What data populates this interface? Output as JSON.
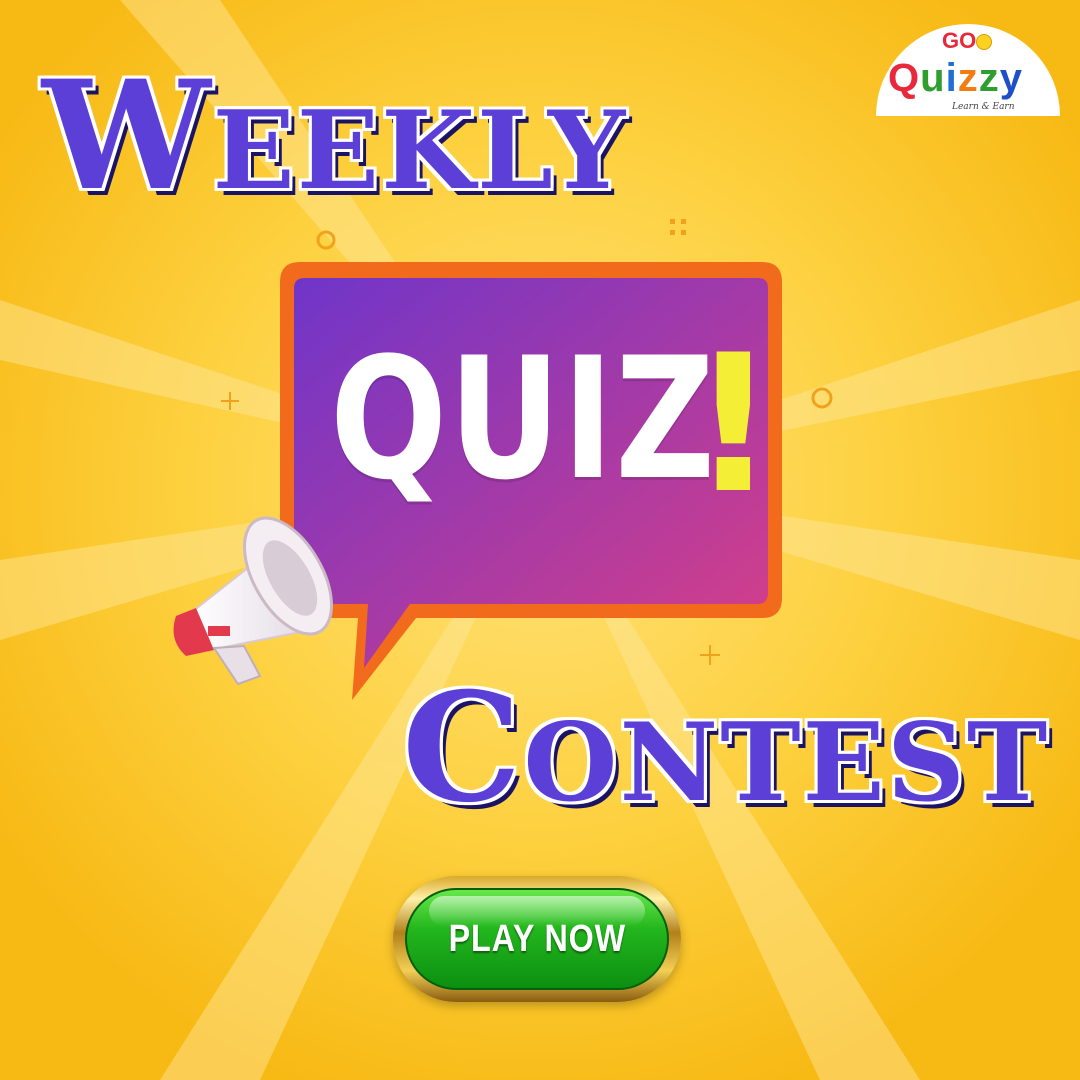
{
  "title_top": {
    "cap": "W",
    "rest": "EEKLY"
  },
  "title_bottom": {
    "cap": "C",
    "rest": "ONTEST"
  },
  "logo": {
    "go": "GO",
    "letters": [
      {
        "ch": "Q",
        "color": "#E8293B"
      },
      {
        "ch": "u",
        "color": "#2E9E2E"
      },
      {
        "ch": "i",
        "color": "#1F6FD6"
      },
      {
        "ch": "z",
        "color": "#F07C12"
      },
      {
        "ch": "z",
        "color": "#2E9E2E"
      },
      {
        "ch": "y",
        "color": "#1F4FC8"
      }
    ],
    "tagline": "Learn & Earn"
  },
  "bubble": {
    "word": "QUIZ",
    "mark": "!"
  },
  "play_button": {
    "label": "PLAY NOW"
  },
  "colors": {
    "background": "#FDC82A",
    "title": "#5B3FD6",
    "bubble_start": "#6F35C9",
    "bubble_end": "#D83F86",
    "bubble_border": "#F26A1B",
    "exclaim": "#F5EE36",
    "button_green": "#23B61D"
  },
  "icons": [
    "megaphone-icon",
    "sparkle-icon",
    "ring-icon",
    "dots-icon"
  ]
}
